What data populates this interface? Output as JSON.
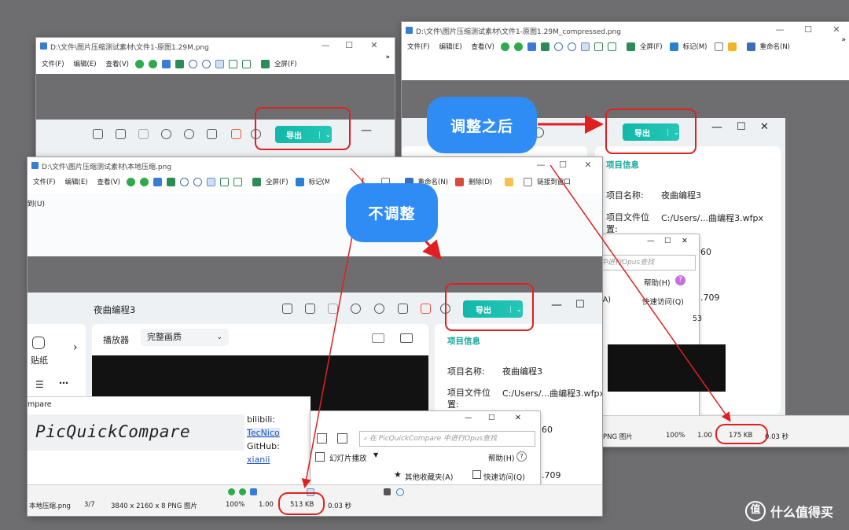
{
  "window_back_left": {
    "title": "D:\\文件\\图片压缩测试素材\\文件1-原图1.29M.png",
    "menu": [
      "文件(F)",
      "编辑(E)",
      "查看(V)"
    ],
    "fullscreen": "全屏(F)",
    "chevron": "»"
  },
  "window_back_right": {
    "title": "D:\\文件\\图片压缩测试素材\\文件1-原图1.29M_compressed.png",
    "menu": [
      "文件(F)",
      "编辑(E)",
      "查看(V)"
    ],
    "fullscreen": "全屏(F)",
    "mark": "标记(M)",
    "rename": "重命名(N)",
    "chevron": "»",
    "export_label": "导出",
    "info_tab": "项目信息",
    "project_name_label": "项目名称:",
    "project_name_value": "夜曲编程3",
    "project_path_label": "项目文件位置:",
    "project_path_value": "C:/Users/...曲编程3.wfpx",
    "partial_values": [
      "60",
      ".709",
      "53"
    ],
    "dialog_search": "中进行Opus查找",
    "dialog_help": "帮助(H)",
    "dialog_quick": "快速访问(Q)",
    "dialog_a": "(A)",
    "status": {
      "format": "PNG 图片",
      "zoom": "100%",
      "scale": "1.00",
      "size": "175 KB",
      "time": "0.03 秒"
    }
  },
  "window_front": {
    "title": "D:\\文件\\图片压缩测试素材\\本地压缩.png",
    "menu": [
      "文件(F)",
      "编辑(E)",
      "查看(V)"
    ],
    "fullscreen": "全屏(F)",
    "mark": "标记(M)",
    "rename": "重命名(N)",
    "delete": "删除(D)",
    "link": "链接到(U)",
    "sub_text": "链接到窗口",
    "app_title": "夜曲编程3",
    "export_label": "导出",
    "sticker": "贴纸",
    "player_label": "播放器",
    "quality": "完整画质",
    "info_tab": "项目信息",
    "project_name_label": "项目名称:",
    "project_name_value": "夜曲编程3",
    "project_path_label": "项目文件位置:",
    "project_path_value": "C:/Users/...曲编程3.wfpx",
    "partial_values": [
      "60",
      ".709"
    ],
    "compare_title": "mpare",
    "compare_logo": "PicQuickCompare",
    "bilibili_label": "bilibili:",
    "bilibili_value": "TecNico",
    "github_label": "GitHub:",
    "github_value": "xianii",
    "dialog_search": "在 PicQuickCompare 中进行Opus查找",
    "dialog_slideshow": "幻灯片播放",
    "dialog_help": "帮助(H)",
    "dialog_fav": "其他收藏夹(A)",
    "dialog_quick": "快速访问(Q)",
    "status": {
      "file": "本地压缩.png",
      "index": "3/7",
      "dims": "3840 x 2160 x 8 PNG 图片",
      "zoom": "100%",
      "scale": "1.00",
      "size": "513 KB",
      "time": "0.03 秒"
    }
  },
  "annotations": {
    "after_label": "调整之后",
    "before_label": "不调整"
  },
  "watermark": "什么值得买",
  "colors": {
    "accent_red": "#e02020",
    "bubble_blue": "#2f8cf4",
    "export_teal": "#13b5a5"
  }
}
